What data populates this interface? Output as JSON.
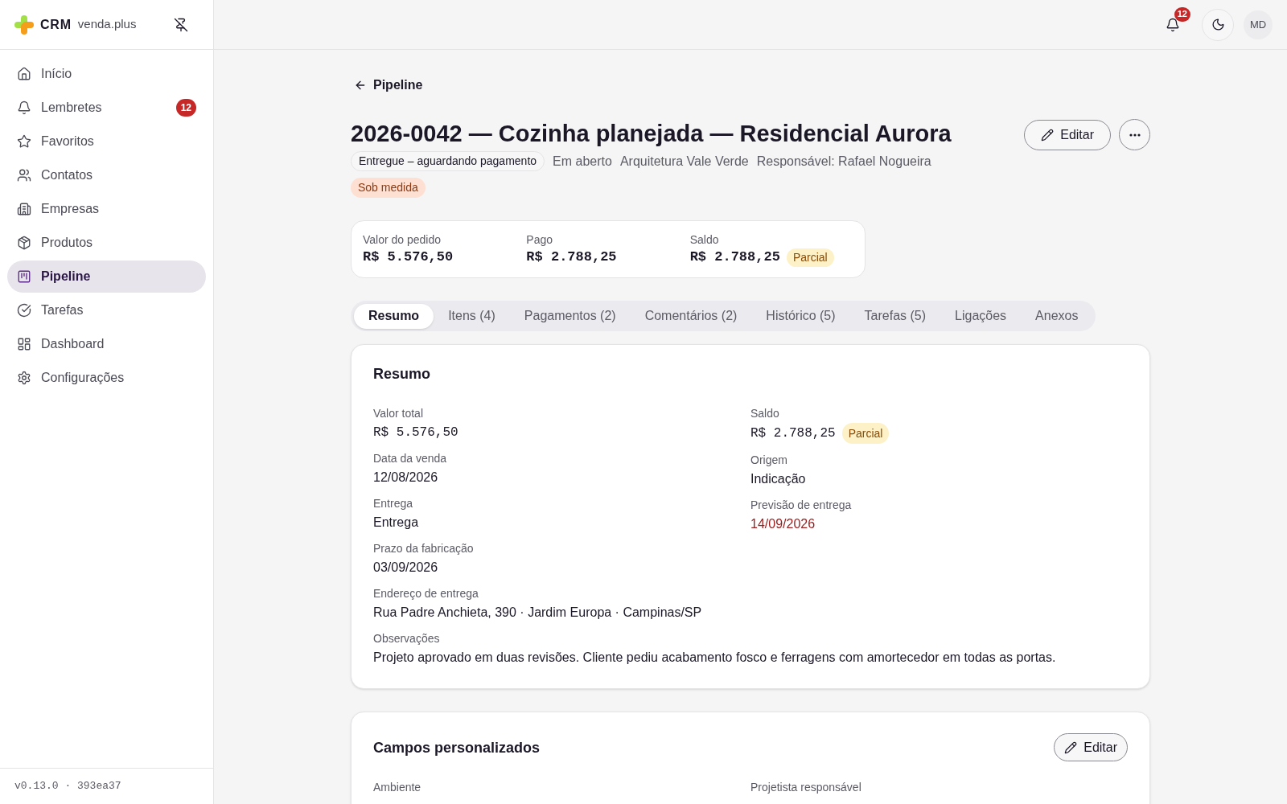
{
  "sidebar": {
    "brand": {
      "name": "CRM",
      "domain": "venda.plus"
    },
    "items": [
      {
        "label": "Início",
        "selected": false
      },
      {
        "label": "Lembretes",
        "selected": false,
        "badge": "12"
      },
      {
        "label": "Favoritos",
        "selected": false
      },
      {
        "label": "Contatos",
        "selected": false
      },
      {
        "label": "Empresas",
        "selected": false
      },
      {
        "label": "Produtos",
        "selected": false
      },
      {
        "label": "Pipeline",
        "selected": true
      },
      {
        "label": "Tarefas",
        "selected": false
      },
      {
        "label": "Dashboard",
        "selected": false
      },
      {
        "label": "Configurações",
        "selected": false
      }
    ],
    "version": "v0.13.0 · 393ea37"
  },
  "topbar": {
    "notifications_badge": "12",
    "avatar": "MD"
  },
  "back_link": "Pipeline",
  "header": {
    "title": "2026-0042 — Cozinha planejada — Residencial Aurora",
    "status": "Entregue – aguardando pagamento",
    "meta": [
      "Em aberto",
      "Arquitetura Vale Verde",
      "Responsável: Rafael Nogueira"
    ],
    "tags": [
      "Sob medida"
    ],
    "edit_button": "Editar"
  },
  "totals": [
    {
      "label": "Valor do pedido",
      "value": "R$ 5.576,50"
    },
    {
      "label": "Pago",
      "value": "R$ 2.788,25"
    },
    {
      "label": "Saldo",
      "value": "R$ 2.788,25",
      "badge": "Parcial"
    }
  ],
  "tabs": [
    {
      "label": "Resumo",
      "selected": true
    },
    {
      "label": "Itens (4)",
      "selected": false
    },
    {
      "label": "Pagamentos (2)",
      "selected": false
    },
    {
      "label": "Comentários (2)",
      "selected": false
    },
    {
      "label": "Histórico (5)",
      "selected": false
    },
    {
      "label": "Tarefas (5)",
      "selected": false
    },
    {
      "label": "Ligações",
      "selected": false
    },
    {
      "label": "Anexos",
      "selected": false
    }
  ],
  "summary": {
    "title": "Resumo",
    "columns": [
      [
        {
          "label": "Valor total",
          "value": "R$ 5.576,50",
          "kind": "money"
        },
        {
          "label": "Data da venda",
          "value": "12/08/2026",
          "kind": "text"
        },
        {
          "label": "Entrega",
          "value": "Entrega",
          "kind": "text"
        },
        {
          "label": "Prazo da fabricação",
          "value": "03/09/2026",
          "kind": "text"
        }
      ],
      [
        {
          "label": "Saldo",
          "value": "R$ 2.788,25",
          "kind": "money",
          "badge": "Parcial"
        },
        {
          "label": "Origem",
          "value": "Indicação",
          "kind": "text"
        },
        {
          "label": "Previsão de entrega",
          "value": "14/09/2026",
          "kind": "alert"
        }
      ]
    ],
    "wide_fields": [
      {
        "label": "Endereço de entrega",
        "value": "Rua Padre Anchieta, 390 · Jardim Europa · Campinas/SP",
        "kind": "text"
      },
      {
        "label": "Observações",
        "value": "Projeto aprovado em duas revisões. Cliente pediu acabamento fosco e ferragens com amortecedor em todas as portas.",
        "kind": "text"
      }
    ]
  },
  "custom_fields": {
    "title": "Campos personalizados",
    "edit_button": "Editar",
    "labels": [
      "Ambiente",
      "Projetista responsável"
    ]
  }
}
